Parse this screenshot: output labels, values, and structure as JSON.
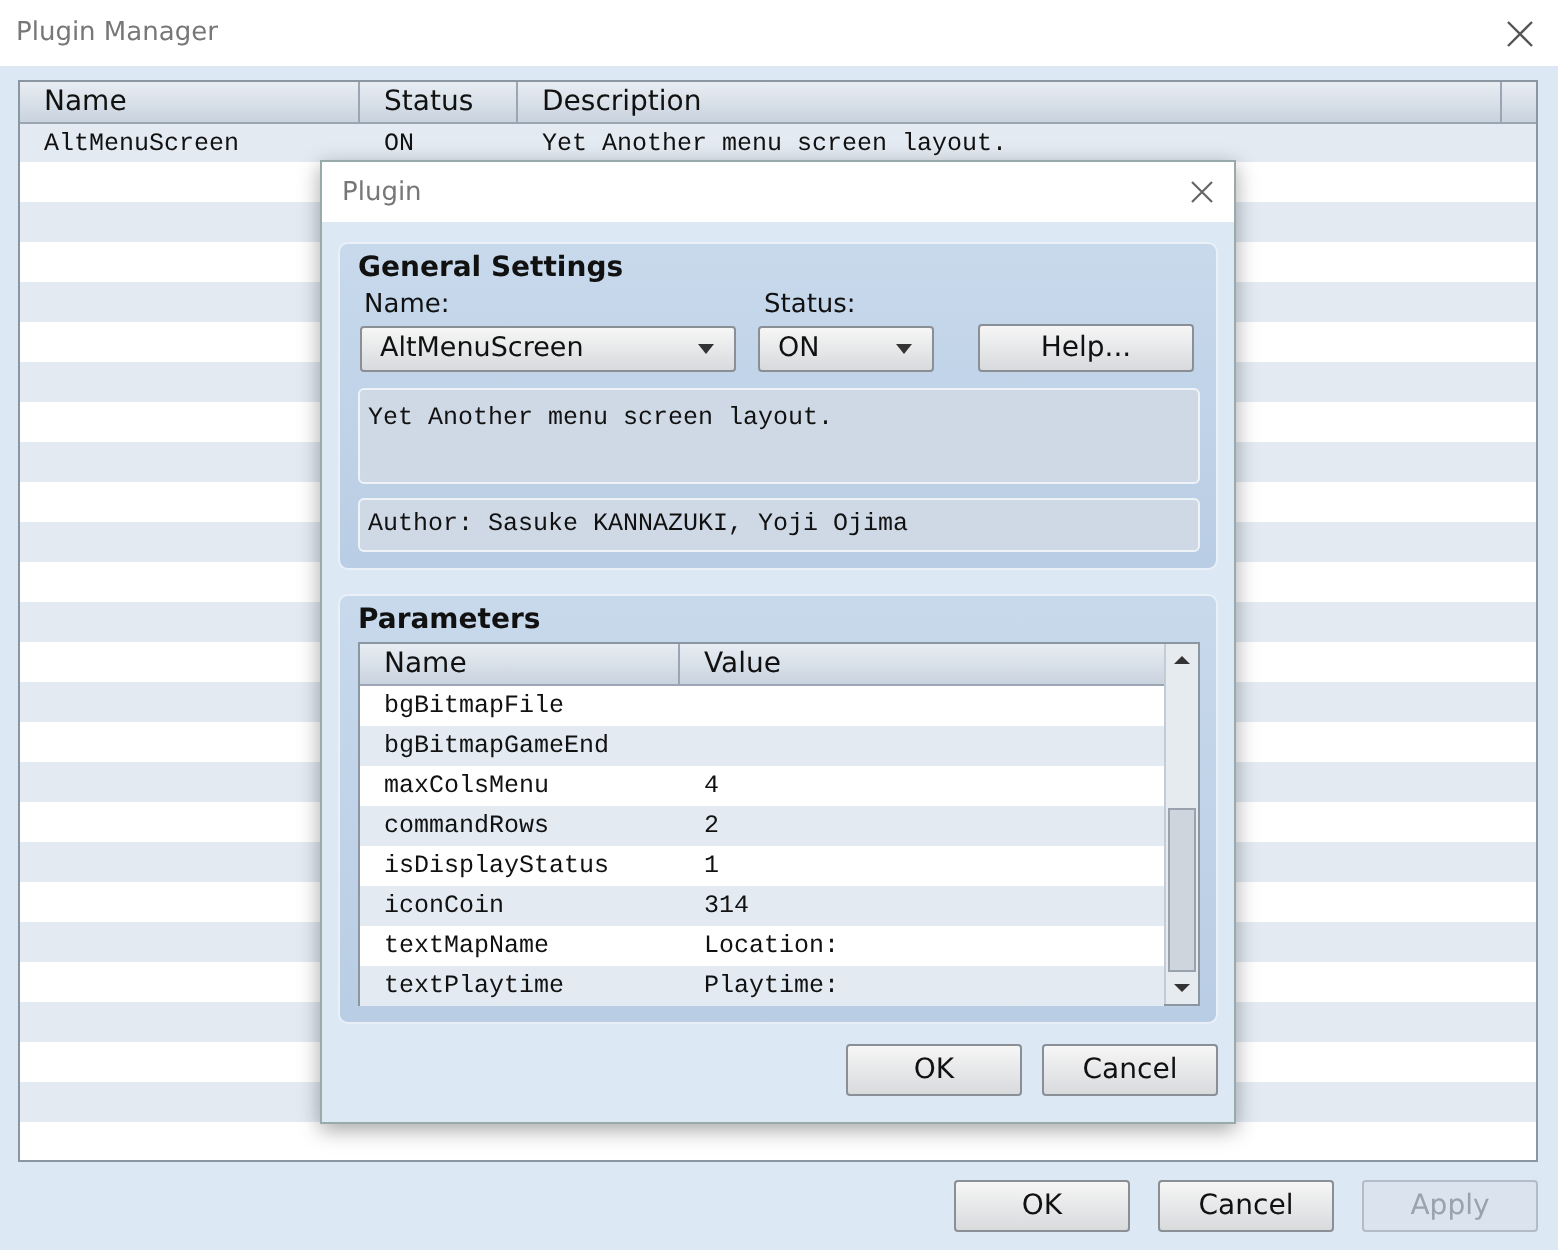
{
  "window": {
    "title": "Plugin Manager"
  },
  "plugins": {
    "columns": [
      "Name",
      "Status",
      "Description"
    ],
    "rows": [
      {
        "name": "AltMenuScreen",
        "status": "ON",
        "description": "Yet Another menu screen layout."
      }
    ]
  },
  "buttons": [
    {
      "label": "OK",
      "disabled": false
    },
    {
      "label": "Cancel",
      "disabled": false
    },
    {
      "label": "Apply",
      "disabled": true
    }
  ],
  "dialog": {
    "title": "Plugin",
    "general": {
      "title": "General Settings",
      "name_label": "Name:",
      "name_value": "AltMenuScreen",
      "status_label": "Status:",
      "status_value": "ON",
      "help_button": "Help...",
      "description": "Yet Another menu screen layout.",
      "author": "Author: Sasuke KANNAZUKI, Yoji Ojima"
    },
    "parameters": {
      "title": "Parameters",
      "columns": [
        "Name",
        "Value"
      ],
      "rows": [
        {
          "name": "bgBitmapFile"
        },
        {
          "name": "bgBitmapGameEnd"
        },
        {
          "name": "maxColsMenu",
          "value": "4"
        },
        {
          "name": "commandRows",
          "value": "2"
        },
        {
          "name": "isDisplayStatus",
          "value": "1"
        },
        {
          "name": "iconCoin",
          "value": "314"
        },
        {
          "name": "textMapName",
          "value": "Location:"
        },
        {
          "name": "textPlaytime",
          "value": "Playtime:"
        }
      ]
    },
    "buttons": [
      {
        "label": "OK",
        "disabled": false
      },
      {
        "label": "Cancel",
        "disabled": false
      }
    ]
  }
}
